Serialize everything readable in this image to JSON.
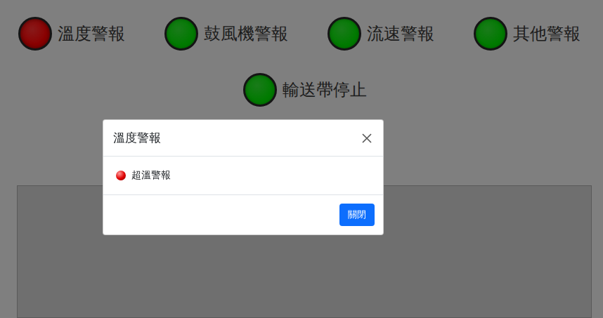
{
  "alarms": [
    {
      "label": "溫度警報",
      "active": true,
      "color": "#8a0000"
    },
    {
      "label": "鼓風機警報",
      "active": false,
      "color": "#007a00"
    },
    {
      "label": "流速警報",
      "active": false,
      "color": "#007a00"
    },
    {
      "label": "其他警報",
      "active": false,
      "color": "#007a00"
    }
  ],
  "conveyor": {
    "label": "輸送帶停止",
    "active": false,
    "color": "#007a00"
  },
  "modal": {
    "title": "溫度警報",
    "items": [
      {
        "label": "超溫警報",
        "active": true,
        "color": "#e00000"
      }
    ],
    "buttons": [
      "關閉"
    ]
  }
}
